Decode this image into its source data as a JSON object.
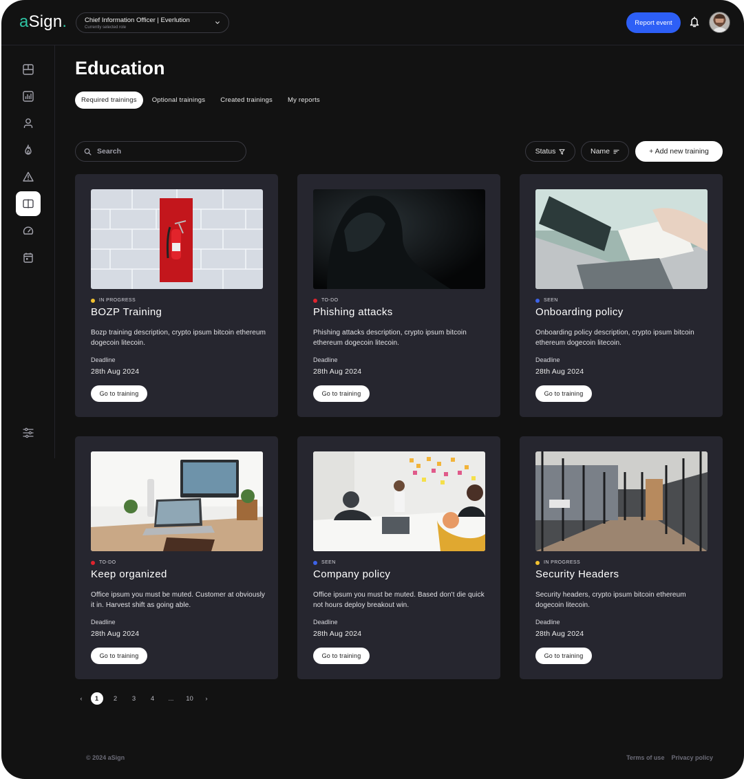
{
  "app": {
    "logo_a": "a",
    "logo_rest": "Sign",
    "logo_dot": "."
  },
  "header": {
    "role_title": "Chief Information Officer | Everlution",
    "role_subtitle": "Currently selected role",
    "report_label": "Report event",
    "icons": [
      "chevron-down-icon",
      "bell-icon",
      "avatar"
    ]
  },
  "sidebar": {
    "items": [
      {
        "icon": "dashboard-icon",
        "active": false
      },
      {
        "icon": "chart-icon",
        "active": false
      },
      {
        "icon": "user-icon",
        "active": false
      },
      {
        "icon": "fire-icon",
        "active": false
      },
      {
        "icon": "warning-icon",
        "active": false
      },
      {
        "icon": "book-icon",
        "active": true
      },
      {
        "icon": "gauge-icon",
        "active": false
      },
      {
        "icon": "calendar-icon",
        "active": false
      }
    ],
    "bottom_icon": "settings-sliders-icon"
  },
  "page": {
    "title": "Education",
    "tabs": [
      {
        "label": "Required trainings",
        "active": true
      },
      {
        "label": "Optional trainings",
        "active": false
      },
      {
        "label": "Created trainings",
        "active": false
      },
      {
        "label": "My reports",
        "active": false
      }
    ],
    "search_placeholder": "Search",
    "status_filter_label": "Status",
    "name_sort_label": "Name",
    "add_label": "+ Add new training"
  },
  "status_colors": {
    "IN PROGRESS": "#f2c230",
    "TO-DO": "#e0242e",
    "SEEN": "#3d63e8"
  },
  "cards": [
    {
      "status": "IN PROGRESS",
      "title": "BOZP Training",
      "description": "Bozp training description, crypto ipsum bitcoin ethereum dogecoin litecoin.",
      "deadline_label": "Deadline",
      "deadline": "28th Aug 2024",
      "button": "Go to training",
      "image": "fire-extinguisher"
    },
    {
      "status": "TO-DO",
      "title": "Phishing attacks",
      "description": "Phishing attacks description, crypto ipsum bitcoin ethereum dogecoin litecoin.",
      "deadline_label": "Deadline",
      "deadline": "28th Aug 2024",
      "button": "Go to training",
      "image": "hooded-figure"
    },
    {
      "status": "SEEN",
      "title": "Onboarding policy",
      "description": "Onboarding policy description, crypto ipsum bitcoin ethereum dogecoin litecoin.",
      "deadline_label": "Deadline",
      "deadline": "28th Aug 2024",
      "button": "Go to training",
      "image": "laptop-notes"
    },
    {
      "status": "TO-DO",
      "title": "Keep organized",
      "description": "Office ipsum you must be muted. Customer at obviously it in. Harvest shift as going able.",
      "deadline_label": "Deadline",
      "deadline": "28th Aug 2024",
      "button": "Go to training",
      "image": "desk-setup"
    },
    {
      "status": "SEEN",
      "title": "Company policy",
      "description": "Office ipsum you must be muted. Based don't die quick not hours deploy breakout win.",
      "deadline_label": "Deadline",
      "deadline": "28th Aug 2024",
      "button": "Go to training",
      "image": "team-meeting"
    },
    {
      "status": "IN PROGRESS",
      "title": "Security Headers",
      "description": "Security headers, crypto ipsum bitcoin ethereum dogecoin litecoin.",
      "deadline_label": "Deadline",
      "deadline": "28th Aug 2024",
      "button": "Go to training",
      "image": "office-corridor"
    }
  ],
  "pagination": {
    "prev": "‹",
    "pages": [
      "1",
      "2",
      "3",
      "4",
      "...",
      "10"
    ],
    "current": "1",
    "next": "›"
  },
  "footer": {
    "copyright": "© 2024 aSign",
    "links": [
      "Terms of use",
      "Privacy policy"
    ]
  }
}
